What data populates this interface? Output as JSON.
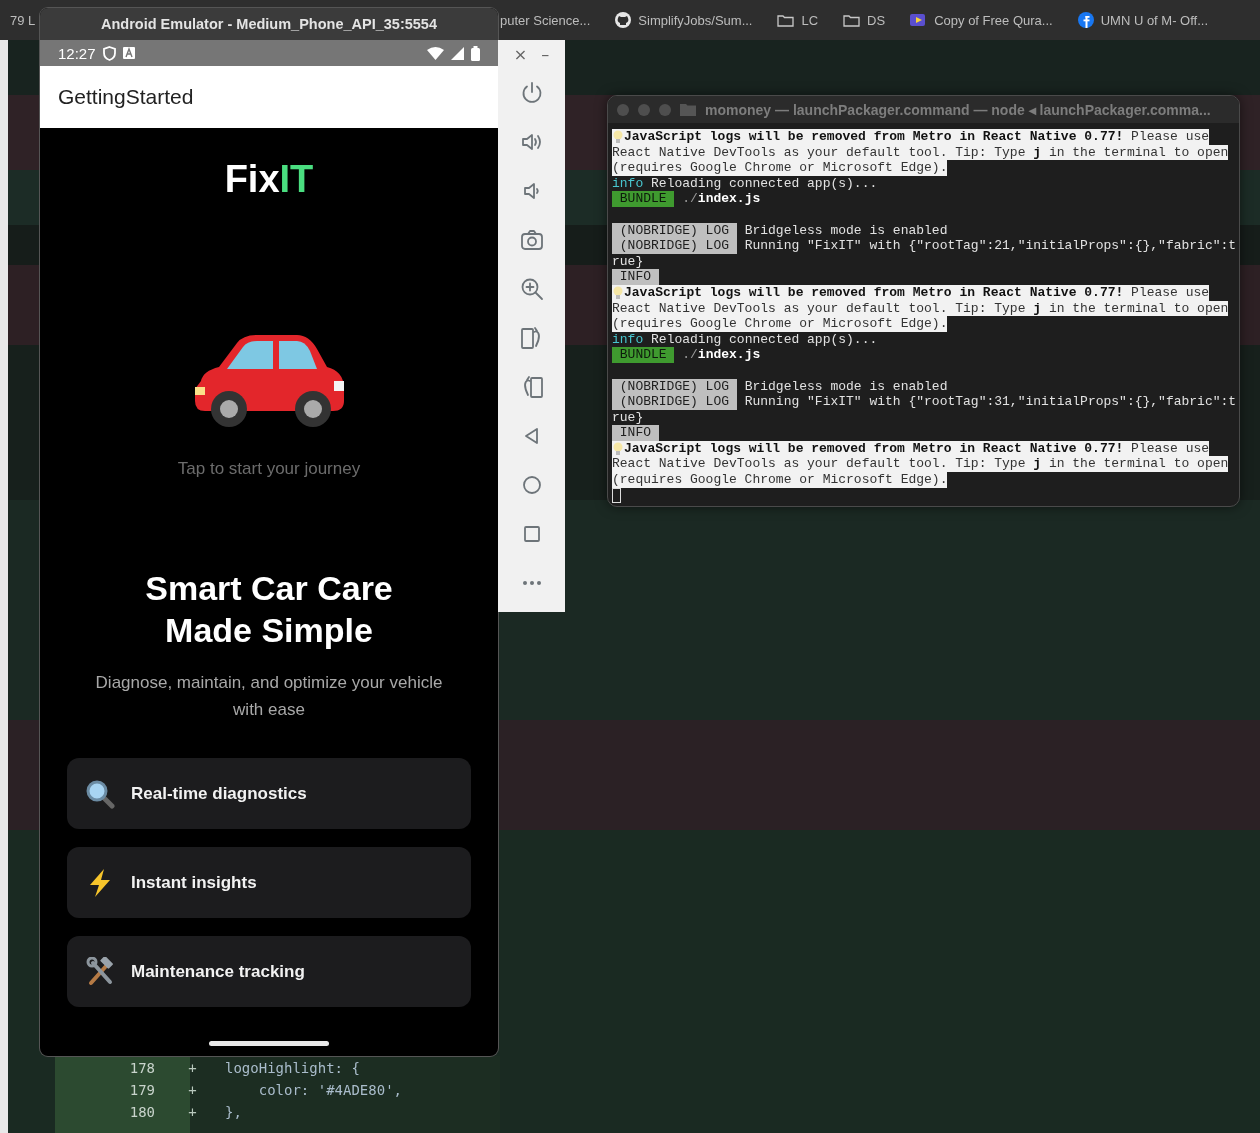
{
  "bookmarks": [
    {
      "label": "79 L",
      "kind": "none"
    },
    {
      "label": "puter Science...",
      "kind": "none"
    },
    {
      "label": "SimplifyJobs/Sum...",
      "kind": "github"
    },
    {
      "label": "LC",
      "kind": "folder"
    },
    {
      "label": "DS",
      "kind": "folder"
    },
    {
      "label": "Copy of Free Qura...",
      "kind": "video"
    },
    {
      "label": "UMN U of M- Off...",
      "kind": "facebook"
    }
  ],
  "emulator": {
    "title": "Android Emulator - Medium_Phone_API_35:5554",
    "status_bar": {
      "time": "12:27"
    },
    "app_bar": {
      "title": "GettingStarted"
    },
    "logo": {
      "text": "Fix",
      "highlight": "IT"
    },
    "tagline": "Tap to start your journey",
    "headline": "Smart Car Care Made Simple",
    "description": "Diagnose, maintain, and optimize your vehicle with ease",
    "features": [
      {
        "kind": "search",
        "label": "Real-time diagnostics"
      },
      {
        "kind": "bolt",
        "label": "Instant insights"
      },
      {
        "kind": "tools",
        "label": "Maintenance tracking"
      }
    ]
  },
  "toolbar": {
    "close": "×",
    "minimize": "–",
    "buttons": [
      {
        "kind": "power"
      },
      {
        "kind": "volume-up"
      },
      {
        "kind": "volume-down"
      },
      {
        "kind": "camera"
      },
      {
        "kind": "zoom-in"
      },
      {
        "kind": "rotate-left"
      },
      {
        "kind": "rotate-right"
      },
      {
        "kind": "back"
      },
      {
        "kind": "home"
      },
      {
        "kind": "overview"
      },
      {
        "kind": "more"
      }
    ]
  },
  "terminal": {
    "title": "momoney — launchPackager.command — node ◂ launchPackager.comma...",
    "lines": [
      {
        "kind": "notice",
        "lines": [
          "**JavaScript logs will be removed from Metro in React Native 0.77!** Please use",
          "React Native DevTools as your default tool. Tip: Type **j** in the terminal to open",
          "(requires Google Chrome or Microsoft Edge)."
        ]
      },
      {
        "kind": "info",
        "label": "info",
        "text": "Reloading connected app(s)..."
      },
      {
        "kind": "bundle",
        "badge": "BUNDLE",
        "text": "./**index.js**"
      },
      {
        "kind": "blank"
      },
      {
        "kind": "log",
        "badge": "(NOBRIDGE) LOG",
        "text": "Bridgeless mode is enabled"
      },
      {
        "kind": "log",
        "badge": "(NOBRIDGE) LOG",
        "text": "Running \"FixIT\" with {\"rootTag\":21,\"initialProps\":{},\"fabric\":t"
      },
      {
        "kind": "plain",
        "text": "rue}"
      },
      {
        "kind": "badge",
        "badge": "INFO"
      },
      {
        "kind": "notice",
        "lines": [
          "**JavaScript logs will be removed from Metro in React Native 0.77!** Please use",
          "React Native DevTools as your default tool. Tip: Type **j** in the terminal to open",
          "(requires Google Chrome or Microsoft Edge)."
        ]
      },
      {
        "kind": "info",
        "label": "info",
        "text": "Reloading connected app(s)..."
      },
      {
        "kind": "bundle",
        "badge": "BUNDLE",
        "text": "./**index.js**"
      },
      {
        "kind": "blank"
      },
      {
        "kind": "log",
        "badge": "(NOBRIDGE) LOG",
        "text": "Bridgeless mode is enabled"
      },
      {
        "kind": "log",
        "badge": "(NOBRIDGE) LOG",
        "text": "Running \"FixIT\" with {\"rootTag\":31,\"initialProps\":{},\"fabric\":t"
      },
      {
        "kind": "plain",
        "text": "rue}"
      },
      {
        "kind": "badge",
        "badge": "INFO"
      },
      {
        "kind": "notice",
        "lines": [
          "**JavaScript logs will be removed from Metro in React Native 0.77!** Please use",
          "React Native DevTools as your default tool. Tip: Type **j** in the terminal to open",
          "(requires Google Chrome or Microsoft Edge)."
        ]
      },
      {
        "kind": "cursor"
      }
    ]
  },
  "code": {
    "lines": [
      {
        "number": "178",
        "marker": "+",
        "code": "logoHighlight: {"
      },
      {
        "number": "179",
        "marker": "+",
        "code": "    color: '#4ADE80',"
      },
      {
        "number": "180",
        "marker": "+",
        "code": "},"
      }
    ]
  }
}
